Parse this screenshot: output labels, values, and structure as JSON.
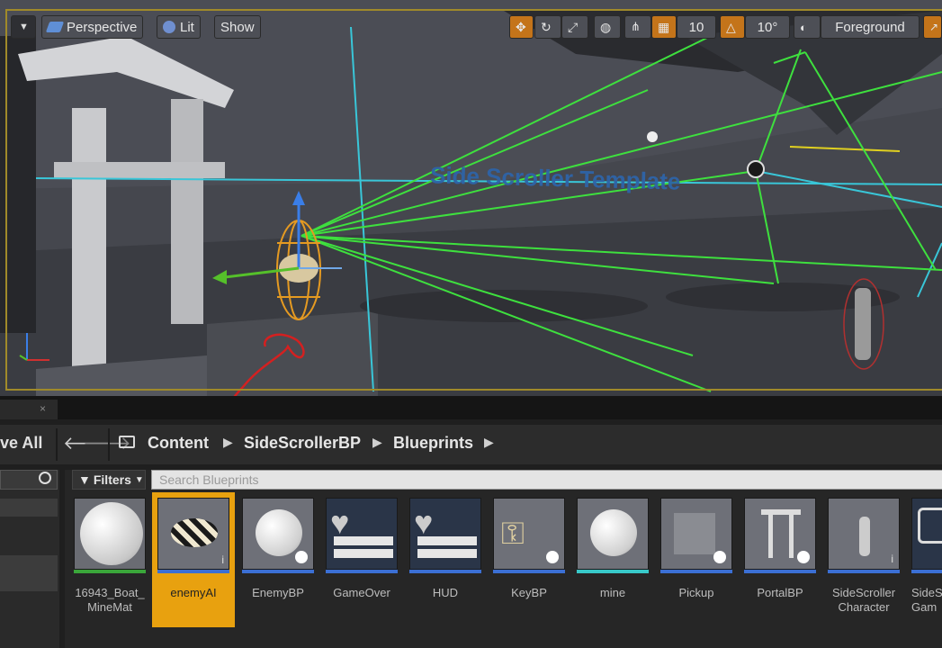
{
  "viewport": {
    "toolbar": {
      "perspective_label": "Perspective",
      "lit_label": "Lit",
      "show_label": "Show",
      "grid_snap_value": "10",
      "rotation_snap_value": "10°",
      "layer_label": "Foreground"
    },
    "scene_text": "Side Scroller Template",
    "colors": {
      "accent": "#c4741a",
      "selection_border": "#a08a2a"
    }
  },
  "content_browser": {
    "save_all_label": "ve All",
    "breadcrumb": [
      "Content",
      "SideScrollerBP",
      "Blueprints"
    ],
    "filters_label": "Filters",
    "search_placeholder": "Search Blueprints",
    "assets": [
      {
        "name": "16943_Boat_MineMat",
        "line1": "16943_Boat_",
        "line2": "MineMat",
        "bar_color": "#3aa63a",
        "selected": false
      },
      {
        "name": "enemyAI",
        "line1": "enemyAI",
        "line2": "",
        "bar_color": "#3b6fd4",
        "selected": true
      },
      {
        "name": "EnemyBP",
        "line1": "EnemyBP",
        "line2": "",
        "bar_color": "#3b6fd4",
        "selected": false
      },
      {
        "name": "GameOver",
        "line1": "GameOver",
        "line2": "",
        "bar_color": "#3b6fd4",
        "selected": false
      },
      {
        "name": "HUD",
        "line1": "HUD",
        "line2": "",
        "bar_color": "#3b6fd4",
        "selected": false
      },
      {
        "name": "KeyBP",
        "line1": "KeyBP",
        "line2": "",
        "bar_color": "#3b6fd4",
        "selected": false
      },
      {
        "name": "mine",
        "line1": "mine",
        "line2": "",
        "bar_color": "#38c9c9",
        "selected": false
      },
      {
        "name": "Pickup",
        "line1": "Pickup",
        "line2": "",
        "bar_color": "#3b6fd4",
        "selected": false
      },
      {
        "name": "PortalBP",
        "line1": "PortalBP",
        "line2": "",
        "bar_color": "#3b6fd4",
        "selected": false
      },
      {
        "name": "SideScrollerCharacter",
        "line1": "SideScroller",
        "line2": "Character",
        "bar_color": "#3b6fd4",
        "selected": false
      },
      {
        "name": "SideScrollerGameMode",
        "line1": "SideS",
        "line2": "Gam",
        "bar_color": "#3b6fd4",
        "selected": false
      }
    ]
  }
}
